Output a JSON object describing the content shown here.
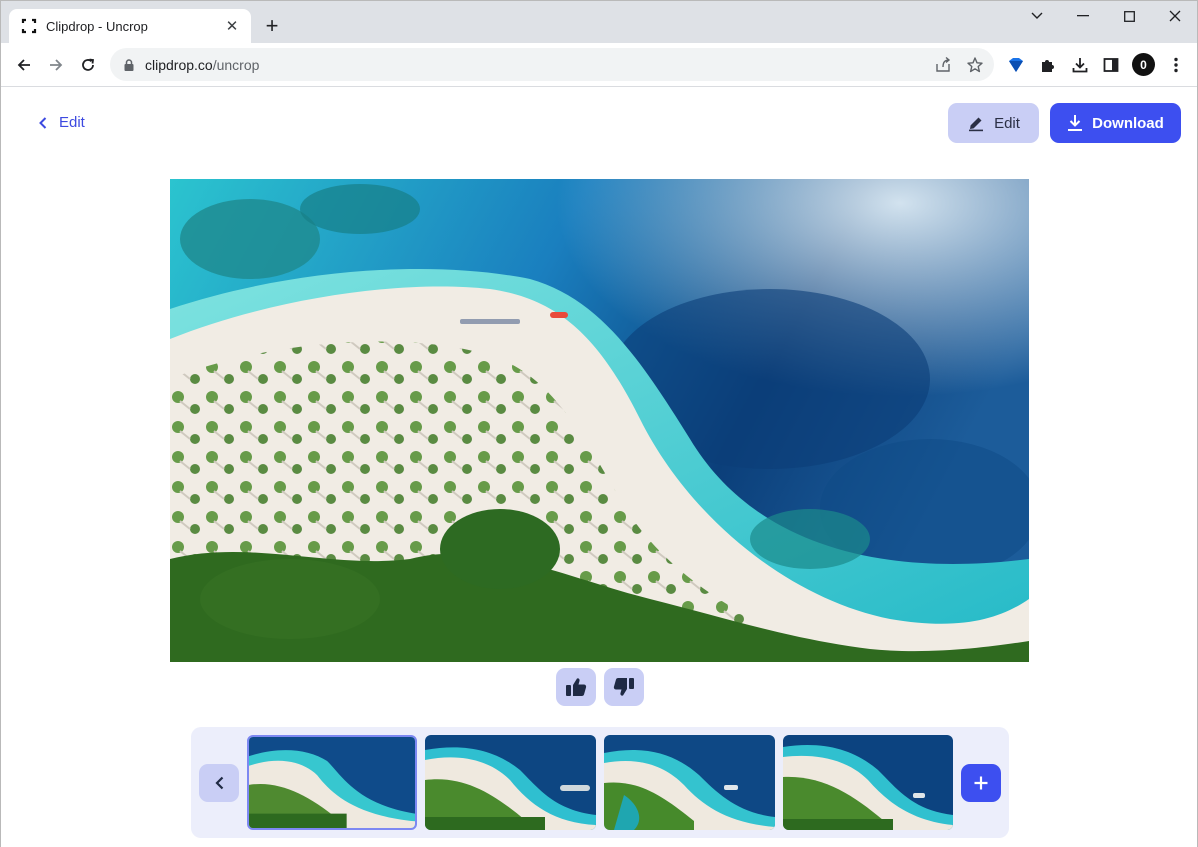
{
  "browser": {
    "tab_title": "Clipdrop - Uncrop",
    "tab_close": "✕",
    "new_tab": "+",
    "url_domain": "clipdrop.co",
    "url_path": "/uncrop",
    "profile_initial": "0"
  },
  "header": {
    "back_label": "Edit",
    "edit_label": "Edit",
    "download_label": "Download"
  },
  "colors": {
    "accent": "#3d4ff0",
    "accent_soft": "#c9cef5",
    "link": "#3d4ae0",
    "thumbbar_bg": "#eceefb"
  },
  "icons": {
    "favicon": "clipdrop-icon",
    "thumbs_up": "thumbs-up-icon",
    "thumbs_down": "thumbs-down-icon",
    "add": "plus-icon",
    "prev": "chevron-left-icon"
  },
  "thumbnails": {
    "selected_index": 0,
    "items": [
      {
        "variant": "1"
      },
      {
        "variant": "2"
      },
      {
        "variant": "3"
      },
      {
        "variant": "4"
      }
    ]
  }
}
